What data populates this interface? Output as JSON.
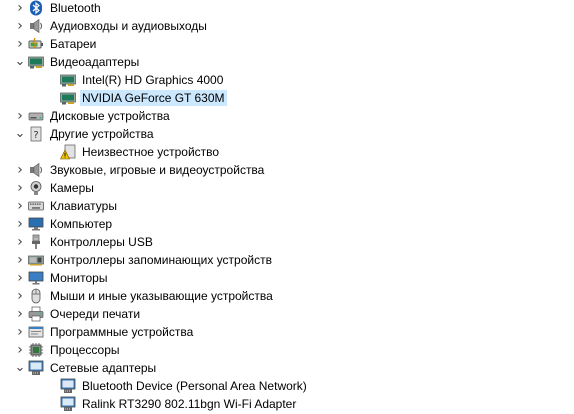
{
  "tree": {
    "items": [
      {
        "label": "Bluetooth",
        "icon": "bluetooth-icon",
        "level": 0,
        "expanded": false
      },
      {
        "label": "Аудиовходы и аудиовыходы",
        "icon": "speaker-icon",
        "level": 0,
        "expanded": false
      },
      {
        "label": "Батареи",
        "icon": "battery-icon",
        "level": 0,
        "expanded": false
      },
      {
        "label": "Видеоадаптеры",
        "icon": "display-adapter-icon",
        "level": 0,
        "expanded": true
      },
      {
        "label": "Intel(R) HD Graphics 4000",
        "icon": "display-adapter-icon",
        "level": 1
      },
      {
        "label": "NVIDIA GeForce GT 630M",
        "icon": "display-adapter-icon",
        "level": 1,
        "selected": true
      },
      {
        "label": "Дисковые устройства",
        "icon": "disk-drive-icon",
        "level": 0,
        "expanded": false
      },
      {
        "label": "Другие устройства",
        "icon": "unknown-device-icon",
        "level": 0,
        "expanded": true
      },
      {
        "label": "Неизвестное устройство",
        "icon": "warning-device-icon",
        "level": 1
      },
      {
        "label": "Звуковые, игровые и видеоустройства",
        "icon": "speaker-icon",
        "level": 0,
        "expanded": false
      },
      {
        "label": "Камеры",
        "icon": "camera-icon",
        "level": 0,
        "expanded": false
      },
      {
        "label": "Клавиатуры",
        "icon": "keyboard-icon",
        "level": 0,
        "expanded": false
      },
      {
        "label": "Компьютер",
        "icon": "computer-icon",
        "level": 0,
        "expanded": false
      },
      {
        "label": "Контроллеры USB",
        "icon": "usb-icon",
        "level": 0,
        "expanded": false
      },
      {
        "label": "Контроллеры запоминающих устройств",
        "icon": "storage-controller-icon",
        "level": 0,
        "expanded": false
      },
      {
        "label": "Мониторы",
        "icon": "monitor-icon",
        "level": 0,
        "expanded": false
      },
      {
        "label": "Мыши и иные указывающие устройства",
        "icon": "mouse-icon",
        "level": 0,
        "expanded": false
      },
      {
        "label": "Очереди печати",
        "icon": "printer-icon",
        "level": 0,
        "expanded": false
      },
      {
        "label": "Программные устройства",
        "icon": "software-device-icon",
        "level": 0,
        "expanded": false
      },
      {
        "label": "Процессоры",
        "icon": "processor-icon",
        "level": 0,
        "expanded": false
      },
      {
        "label": "Сетевые адаптеры",
        "icon": "network-adapter-icon",
        "level": 0,
        "expanded": true
      },
      {
        "label": "Bluetooth Device (Personal Area Network)",
        "icon": "network-adapter-icon",
        "level": 1
      },
      {
        "label": "Ralink RT3290 802.11bgn Wi-Fi Adapter",
        "icon": "network-adapter-icon",
        "level": 1
      }
    ]
  },
  "colors": {
    "selection": "#cce8ff",
    "bluetooth": "#1a5fb4",
    "warning": "#f2c200"
  }
}
